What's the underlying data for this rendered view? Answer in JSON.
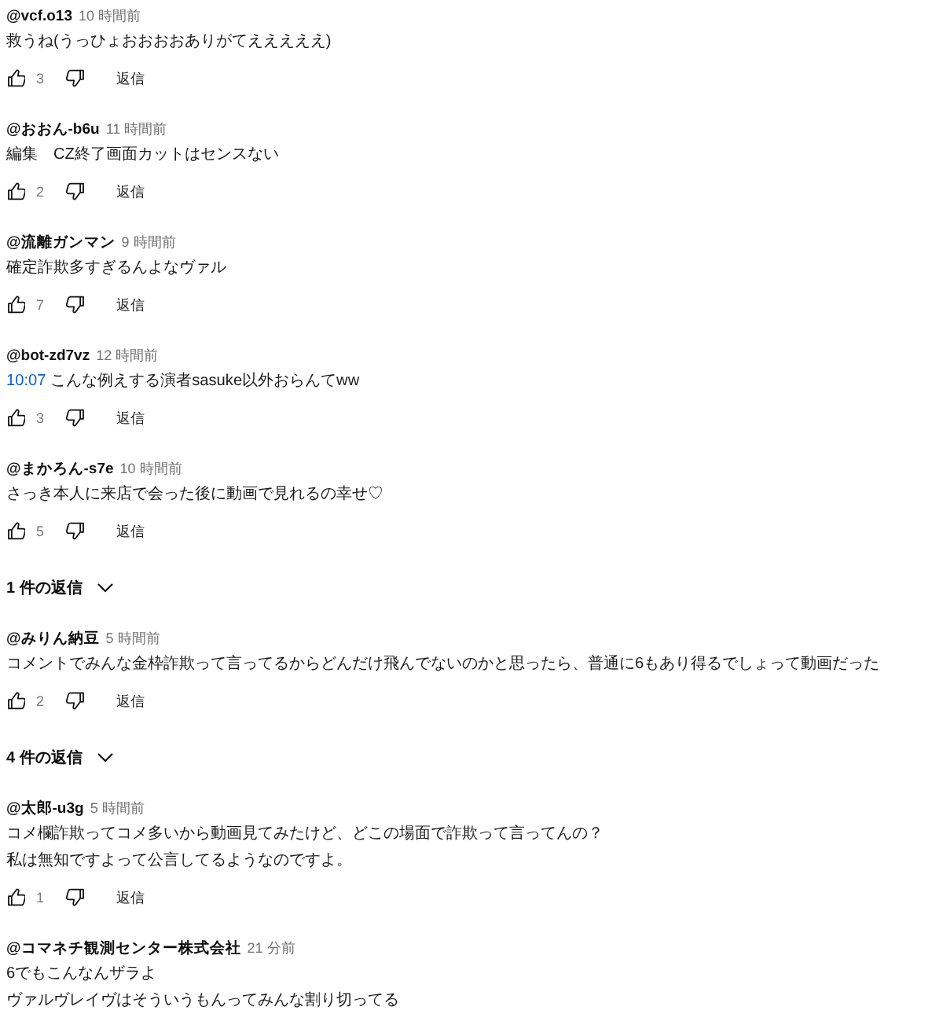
{
  "comments": [
    {
      "kind": "comment",
      "author": "@vcf.o13",
      "time": "10 時間前",
      "lines": [
        "救うね(うっひょおおおおありがてえええええ)"
      ],
      "likes": "3",
      "reply_button": "返信"
    },
    {
      "kind": "comment",
      "author": "@おおん-b6u",
      "time": "11 時間前",
      "lines": [
        "編集　CZ終了画面カットはセンスない"
      ],
      "likes": "2",
      "reply_button": "返信"
    },
    {
      "kind": "comment",
      "author": "@流離ガンマン",
      "time": "9 時間前",
      "lines": [
        "確定詐欺多すぎるんよなヴァル"
      ],
      "likes": "7",
      "reply_button": "返信"
    },
    {
      "kind": "comment",
      "author": "@bot-zd7vz",
      "time": "12 時間前",
      "timestamp": "10:07",
      "lines": [
        "こんな例えする演者sasuke以外おらんてww"
      ],
      "likes": "3",
      "reply_button": "返信"
    },
    {
      "kind": "comment",
      "author": "@まかろん-s7e",
      "time": "10 時間前",
      "lines": [
        "さっき本人に来店で会った後に動画で見れるの幸せ♡"
      ],
      "likes": "5",
      "reply_button": "返信"
    },
    {
      "kind": "replies",
      "label": "1 件の返信"
    },
    {
      "kind": "comment",
      "author": "@みりん納豆",
      "time": "5 時間前",
      "lines": [
        "コメントでみんな金枠詐欺って言ってるからどんだけ飛んでないのかと思ったら、普通に6もあり得るでしょって動画だった"
      ],
      "likes": "2",
      "reply_button": "返信"
    },
    {
      "kind": "replies",
      "label": "4 件の返信"
    },
    {
      "kind": "comment",
      "author": "@太郎-u3g",
      "time": "5 時間前",
      "lines": [
        "コメ欄詐欺ってコメ多いから動画見てみたけど、どこの場面で詐欺って言ってんの？",
        "私は無知ですよって公言してるようなのですよ。"
      ],
      "likes": "1",
      "reply_button": "返信"
    },
    {
      "kind": "comment",
      "author": "@コマネチ観測センター株式会社",
      "time": "21 分前",
      "lines": [
        "6でもこんなんザラよ",
        "ヴァルヴレイヴはそういうもんってみんな割り切ってる"
      ]
    }
  ]
}
